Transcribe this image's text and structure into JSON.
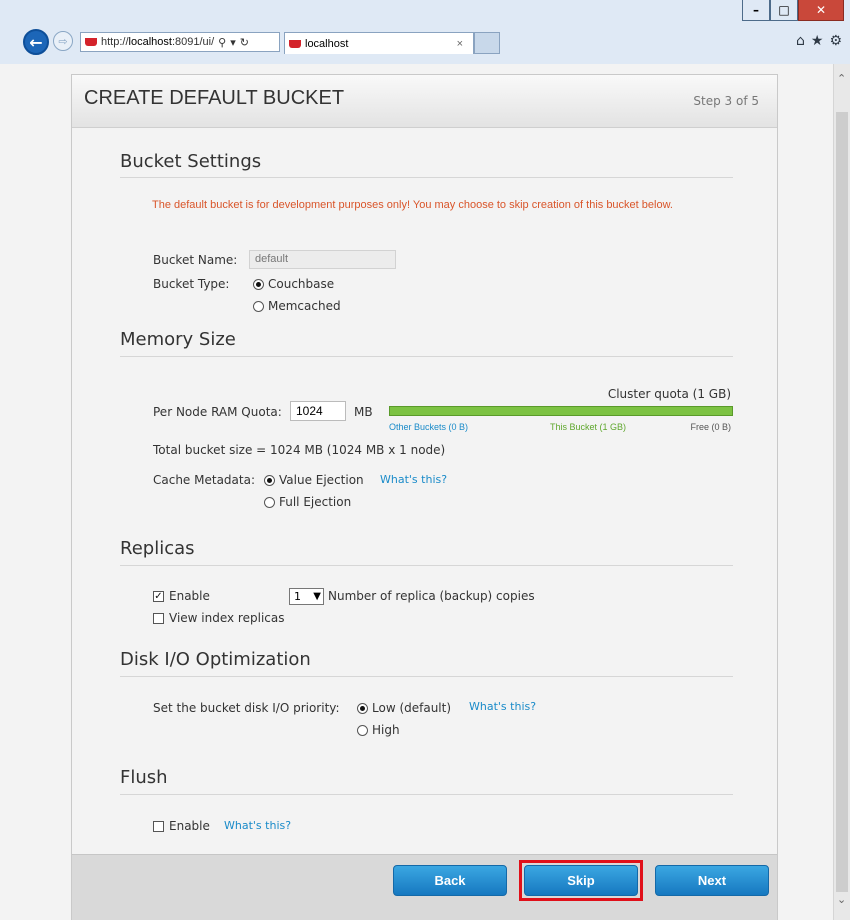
{
  "browser": {
    "url_prefix": "http://",
    "url_host": "localhost",
    "url_rest": ":8091/ui/",
    "tab_title": "localhost",
    "search_glyph": "⚲",
    "dropdown_glyph": "▾",
    "refresh_glyph": "↻",
    "close_tab_glyph": "×",
    "window_buttons": {
      "minimize": "–",
      "maximize": "□",
      "close": "✕"
    },
    "back_glyph": "←",
    "forward_glyph": "⇨",
    "tools": {
      "home": "⌂",
      "favorites": "★",
      "settings": "⚙"
    }
  },
  "dialog": {
    "title": "CREATE DEFAULT BUCKET",
    "step": "Step 3 of 5"
  },
  "bucket_settings": {
    "heading": "Bucket Settings",
    "warning": "The default bucket is for development purposes only! You may choose to skip creation of this bucket below.",
    "name_label": "Bucket Name:",
    "name_value": "default",
    "type_label": "Bucket Type:",
    "type_options": [
      {
        "label": "Couchbase",
        "selected": true
      },
      {
        "label": "Memcached",
        "selected": false
      }
    ]
  },
  "memory": {
    "heading": "Memory Size",
    "ram_label": "Per Node RAM Quota:",
    "ram_value": "1024",
    "ram_unit": "MB",
    "cluster_quota": "Cluster quota (1 GB)",
    "legend": {
      "other": "Other Buckets (0 B)",
      "this": "This Bucket (1 GB)",
      "free": "Free (0 B)"
    },
    "total": "Total bucket size = 1024 MB (1024 MB x 1 node)",
    "cache_label": "Cache Metadata:",
    "cache_options": [
      {
        "label": "Value Ejection",
        "selected": true
      },
      {
        "label": "Full Ejection",
        "selected": false
      }
    ],
    "help": "What's this?"
  },
  "replicas": {
    "heading": "Replicas",
    "enable_label": "Enable",
    "enable_checked": true,
    "count": "1",
    "count_label": "Number of replica (backup) copies",
    "index_label": "View index replicas",
    "index_checked": false
  },
  "disk_io": {
    "heading": "Disk I/O Optimization",
    "priority_label": "Set the bucket disk I/O priority:",
    "options": [
      {
        "label": "Low (default)",
        "selected": true
      },
      {
        "label": "High",
        "selected": false
      }
    ],
    "help": "What's this?"
  },
  "flush": {
    "heading": "Flush",
    "enable_label": "Enable",
    "enable_checked": false,
    "help": "What's this?"
  },
  "footer": {
    "back": "Back",
    "skip": "Skip",
    "next": "Next"
  },
  "colors": {
    "accent": "#1a8bc9",
    "warning": "#d9552a",
    "bar_green": "#7cc242",
    "highlight": "#e0101a"
  }
}
